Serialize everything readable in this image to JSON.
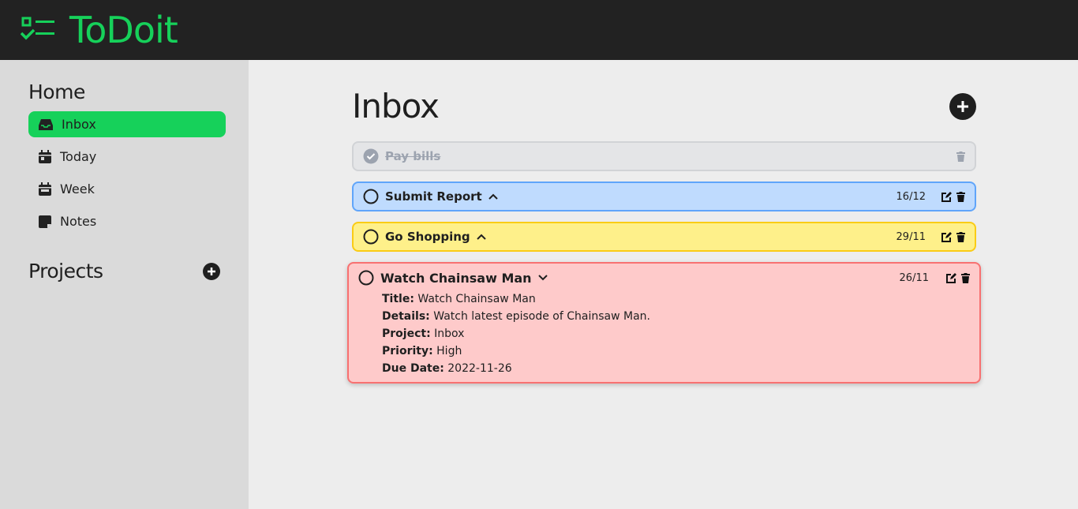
{
  "app": {
    "title": "ToDoit"
  },
  "sidebar": {
    "home_heading": "Home",
    "items": [
      {
        "label": "Inbox"
      },
      {
        "label": "Today"
      },
      {
        "label": "Week"
      },
      {
        "label": "Notes"
      }
    ],
    "projects_heading": "Projects"
  },
  "main": {
    "title": "Inbox"
  },
  "tasks": [
    {
      "title": "Pay bills",
      "done": true
    },
    {
      "title": "Submit Report",
      "date": "16/12"
    },
    {
      "title": "Go Shopping",
      "date": "29/11"
    },
    {
      "title": "Watch Chainsaw Man",
      "date": "26/11",
      "details": {
        "title_label": "Title:",
        "title": "Watch Chainsaw Man",
        "details_label": "Details:",
        "details": "Watch latest episode of Chainsaw Man.",
        "project_label": "Project:",
        "project": "Inbox",
        "priority_label": "Priority:",
        "priority": "High",
        "due_label": "Due Date:",
        "due": "2022-11-26"
      }
    }
  ],
  "colors": {
    "accent": "#16d15a",
    "low": "#bfdbfe",
    "medium": "#fef08a",
    "high": "#fecaca"
  }
}
